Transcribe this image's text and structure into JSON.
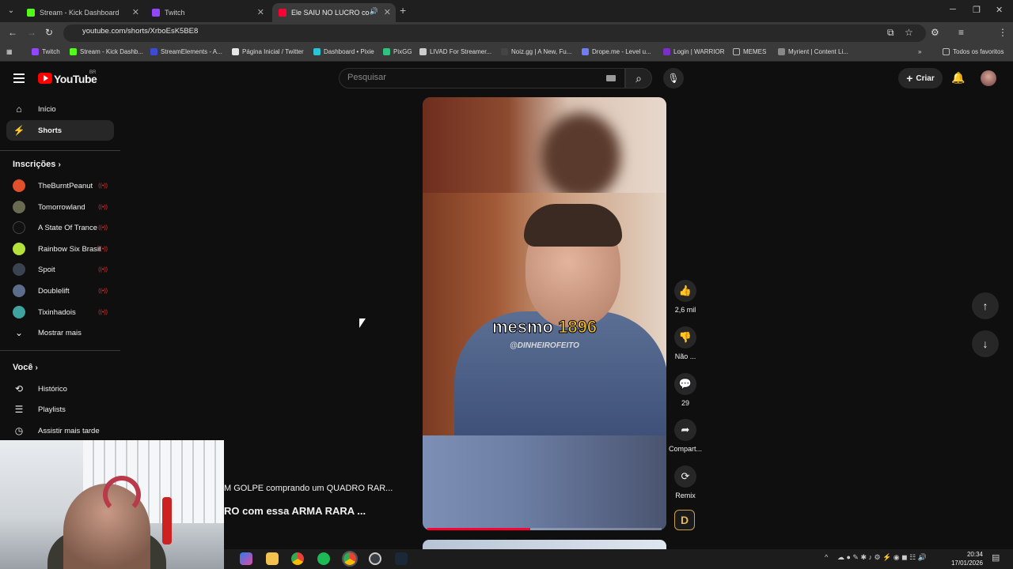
{
  "browser": {
    "tabs": [
      {
        "title": "Stream - Kick Dashboard",
        "color": "#53fc18"
      },
      {
        "title": "Twitch",
        "color": "#9146ff"
      },
      {
        "title": "Ele SAIU NO LUCRO com e",
        "color": "#ff0033"
      }
    ],
    "url": "youtube.com/shorts/XrboEsK5BE8",
    "bookmarks": [
      {
        "label": "Twitch",
        "color": "#9146ff"
      },
      {
        "label": "Stream - Kick Dashb...",
        "color": "#53fc18"
      },
      {
        "label": "StreamElements - A...",
        "color": "#3b4bd8"
      },
      {
        "label": "Página Inicial / Twitter",
        "color": "#e7e7e7"
      },
      {
        "label": "Dashboard • Pixie",
        "color": "#28c5d4"
      },
      {
        "label": "PixGG",
        "color": "#2ec27e"
      },
      {
        "label": "LIVAD For Streamer...",
        "color": "#cccccc"
      },
      {
        "label": "Noiz.gg | A New, Fu...",
        "color": "#444444"
      },
      {
        "label": "Drope.me - Level u...",
        "color": "#6e7cf5"
      },
      {
        "label": "Login | WARRIOR",
        "color": "#7a2fc9"
      },
      {
        "label": "MEMES",
        "color": "#bbbbbb"
      },
      {
        "label": "Myrient | Content Li...",
        "color": "#888888"
      }
    ],
    "all_bookmarks": "Todos os favoritos"
  },
  "header": {
    "logo_text": "YouTube",
    "region": "BR",
    "search_placeholder": "Pesquisar",
    "create_label": "Criar"
  },
  "sidebar": {
    "main": [
      {
        "label": "Início",
        "icon": "home-icon"
      },
      {
        "label": "Shorts",
        "icon": "shorts-icon"
      }
    ],
    "subs_heading": "Inscrições",
    "subscriptions": [
      {
        "label": "TheBurntPeanut",
        "color": "#e0502a"
      },
      {
        "label": "Tomorrowland",
        "color": "#6a6a52"
      },
      {
        "label": "A State Of Trance",
        "color": "#111111"
      },
      {
        "label": "Rainbow Six Brasil",
        "color": "#b4e23a"
      },
      {
        "label": "Spoit",
        "color": "#3a4450"
      },
      {
        "label": "Doublelift",
        "color": "#5a6d8a"
      },
      {
        "label": "Tixinhadois",
        "color": "#3fa3a0"
      }
    ],
    "show_more": "Mostrar mais",
    "you_heading": "Você",
    "you_items": [
      {
        "label": "Histórico",
        "icon": "history-icon"
      },
      {
        "label": "Playlists",
        "icon": "playlists-icon"
      },
      {
        "label": "Assistir mais tarde",
        "icon": "watch-later-icon"
      }
    ]
  },
  "short": {
    "caption_word": "mesmo",
    "caption_highlight": "1896",
    "watermark": "@DINHEIROFEITO",
    "progress": 0.44,
    "actions": {
      "likes": "2,6 mil",
      "dislike": "Não ...",
      "comments": "29",
      "share": "Compart...",
      "remix": "Remix"
    },
    "channel_initial": "D"
  },
  "overlay": {
    "title1": "M GOLPE comprando um QUADRO RAR...",
    "title2": "RO com essa ARMA RARA ..."
  },
  "taskbar": {
    "time": "20:34",
    "date": "17/01/2026"
  }
}
